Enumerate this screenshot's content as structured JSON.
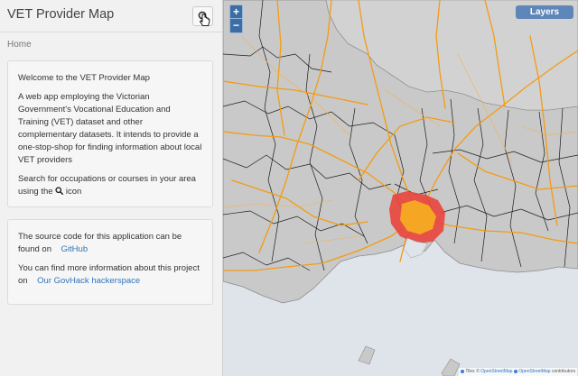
{
  "sidebar": {
    "title": "VET Provider Map",
    "breadcrumb": "Home",
    "welcome": {
      "heading": "Welcome to the VET Provider Map",
      "intro": "A web app employing the Victorian Government's Vocational Education and Training (VET) dataset and other complementary datasets. It intends to provide a one-stop-shop for finding information about local VET providers",
      "search_text_pre": "Search for occupations or courses in your area using the",
      "search_text_post": "icon"
    },
    "source": {
      "code_text": "The source code for this application can be found on",
      "code_link": "GitHub",
      "more_text": "You can find more information about this project on",
      "more_link": "Our GovHack hackerspace"
    }
  },
  "map": {
    "zoom_in": "+",
    "zoom_out": "−",
    "layers_label": "Layers",
    "attribution": {
      "tiles_label": "Tiles ©",
      "tiles_link": "OpenStreetMap",
      "data_link": "OpenStreetMap",
      "data_suffix": "contributors"
    }
  },
  "colors": {
    "land": "#c9c9c9",
    "water": "#dfe4ea",
    "roads": "#f39c12",
    "metro": "#e8473e",
    "accent": "#5e86b8"
  }
}
